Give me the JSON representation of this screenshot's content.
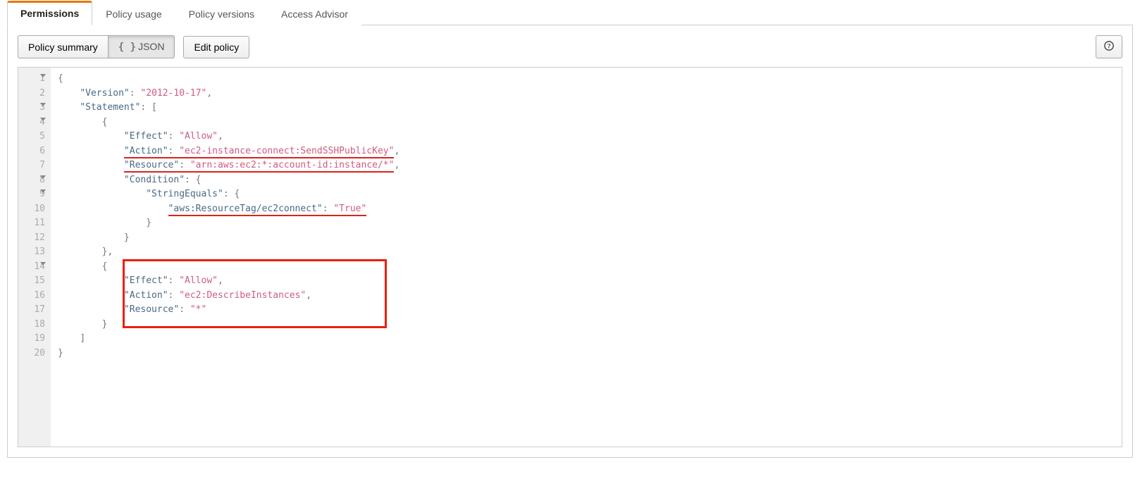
{
  "tabs": {
    "permissions": "Permissions",
    "policy_usage": "Policy usage",
    "policy_versions": "Policy versions",
    "access_advisor": "Access Advisor"
  },
  "toolbar": {
    "policy_summary": "Policy summary",
    "json_label": "JSON",
    "edit_policy": "Edit policy",
    "help_glyph": "?"
  },
  "editor": {
    "line_numbers": {
      "from": 1,
      "to": 20,
      "fold_lines": [
        1,
        3,
        4,
        8,
        9,
        14
      ]
    },
    "tokens": {
      "version_key": "\"Version\"",
      "version_val": "\"2012-10-17\"",
      "statement_key": "\"Statement\"",
      "effect_key": "\"Effect\"",
      "allow_val": "\"Allow\"",
      "action_key": "\"Action\"",
      "action1_val": "\"ec2-instance-connect:SendSSHPublicKey\"",
      "resource_key": "\"Resource\"",
      "resource1_val": "\"arn:aws:ec2:*:account-id:instance/*\"",
      "condition_key": "\"Condition\"",
      "string_equals_key": "\"StringEquals\"",
      "tag_key": "\"aws:ResourceTag/ec2connect\"",
      "true_val": "\"True\"",
      "action2_val": "\"ec2:DescribeInstances\"",
      "star_val": "\"*\""
    }
  }
}
